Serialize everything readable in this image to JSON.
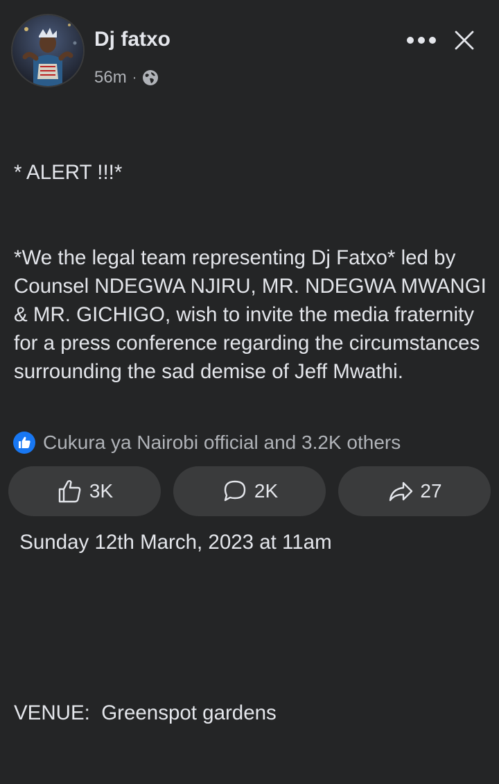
{
  "post": {
    "author": "Dj fatxo",
    "time": "56m",
    "separator": "·",
    "privacy_icon": "globe-icon",
    "lines": [
      "* ALERT !!!*",
      "*We the legal team representing Dj Fatxo* led by Counsel NDEGWA NJIRU, MR. NDEGWA MWANGI & MR. GICHIGO, wish to invite the media fraternity for a press conference regarding the circumstances surrounding the sad demise of Jeff Mwathi.",
      "",
      " Sunday 12th March, 2023 at 11am",
      "",
      "VENUE:  Greenspot gardens"
    ]
  },
  "reactions": {
    "summary": "Cukura ya Nairobi official and 3.2K others",
    "icon": "like-badge-icon",
    "color": "#1877f2"
  },
  "actions": {
    "like_count": "3K",
    "comment_count": "2K",
    "share_count": "27"
  },
  "colors": {
    "background": "#242526",
    "button_bg": "#3a3b3c",
    "text": "#e4e6eb",
    "secondary_text": "#b0b3b8"
  }
}
